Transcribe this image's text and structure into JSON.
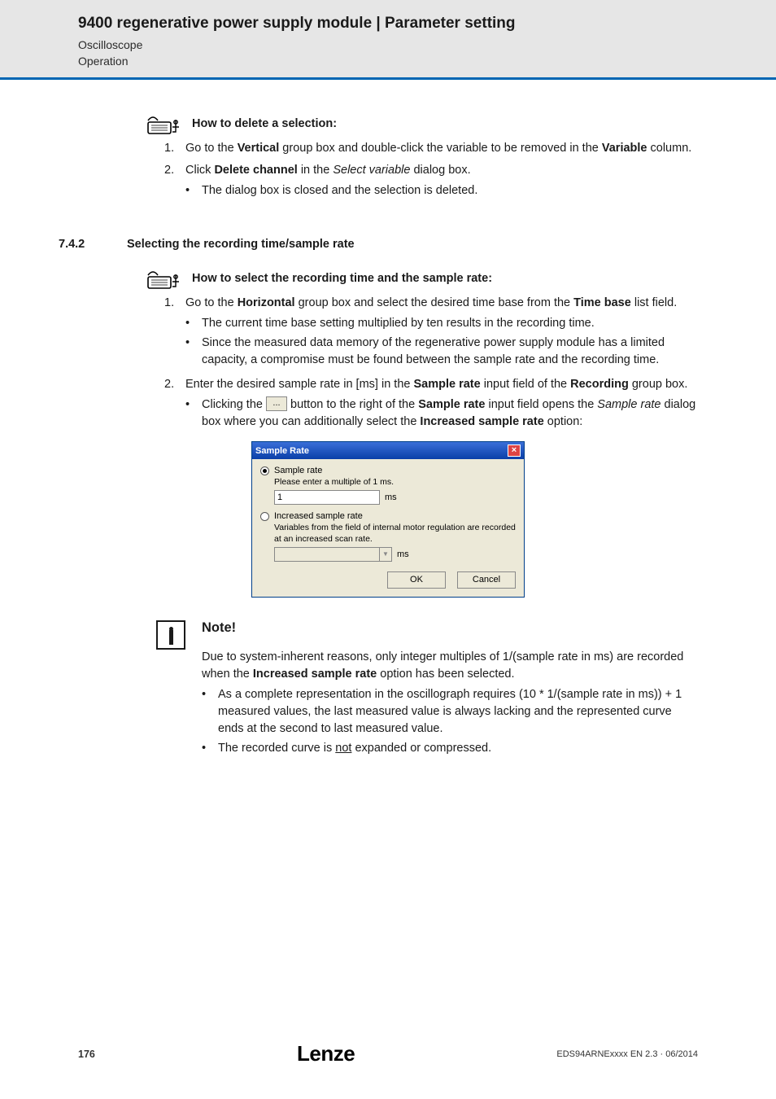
{
  "header": {
    "title": "9400 regenerative power supply module | Parameter setting",
    "sub1": "Oscilloscope",
    "sub2": "Operation"
  },
  "proc1": {
    "label": "How to delete a selection:",
    "items": [
      {
        "num": "1.",
        "parts": [
          "Go to the ",
          "Vertical",
          " group box and double-click the variable to be removed in the ",
          "Variable",
          " column."
        ]
      },
      {
        "num": "2.",
        "parts": [
          "Click ",
          "Delete channel",
          " in the ",
          "Select variable",
          " dialog box."
        ],
        "sub": [
          "The dialog box is closed and the selection is deleted."
        ]
      }
    ]
  },
  "section": {
    "num": "7.4.2",
    "title": "Selecting the recording time/sample rate"
  },
  "proc2": {
    "label": "How to select the recording time and the sample rate:",
    "items": [
      {
        "num": "1.",
        "parts": [
          "Go to the ",
          "Horizontal",
          " group box and select the desired time base from the ",
          "Time base",
          " list field."
        ],
        "sub": [
          "The current time base setting multiplied by ten results in the recording time.",
          "Since the measured data memory of the regenerative power supply module has a limited capacity, a compromise must be found between the sample rate and the recording time."
        ]
      },
      {
        "num": "2.",
        "parts": [
          "Enter the desired sample rate in [ms] in the ",
          "Sample rate",
          " input field of the ",
          "Recording",
          " group box."
        ],
        "sub_complex": {
          "pre": "Clicking the ",
          "btn": "...",
          "mid": " button to the right of the ",
          "b1": "Sample rate",
          "mid2": " input field opens the ",
          "i1": "Sample rate",
          "mid3": " dialog box where you can additionally select the ",
          "b2": "Increased sample rate",
          "post": " option:"
        }
      }
    ]
  },
  "dialog": {
    "title": "Sample Rate",
    "opt1_label": "Sample rate",
    "opt1_hint": "Please enter a multiple of 1 ms.",
    "opt1_value": "1",
    "unit": "ms",
    "opt2_label": "Increased sample rate",
    "opt2_hint": "Variables from the field of internal motor regulation  are recorded at an increased scan rate.",
    "ok": "OK",
    "cancel": "Cancel"
  },
  "note": {
    "title": "Note!",
    "body_pre": "Due to system-inherent reasons, only integer multiples of 1/(sample rate in ms) are recorded when the ",
    "body_bold": "Increased sample rate",
    "body_post": " option has been selected.",
    "ul": [
      "As a complete representation in the oscillograph requires (10 * 1/(sample rate in ms)) + 1 measured values, the last measured value is always lacking and the represented curve ends at the second to last measured value.",
      {
        "pre": "The recorded curve is ",
        "u": "not",
        "post": " expanded or compressed."
      }
    ]
  },
  "footer": {
    "page": "176",
    "logo": "Lenze",
    "docid": "EDS94ARNExxxx EN 2.3 · 06/2014"
  }
}
